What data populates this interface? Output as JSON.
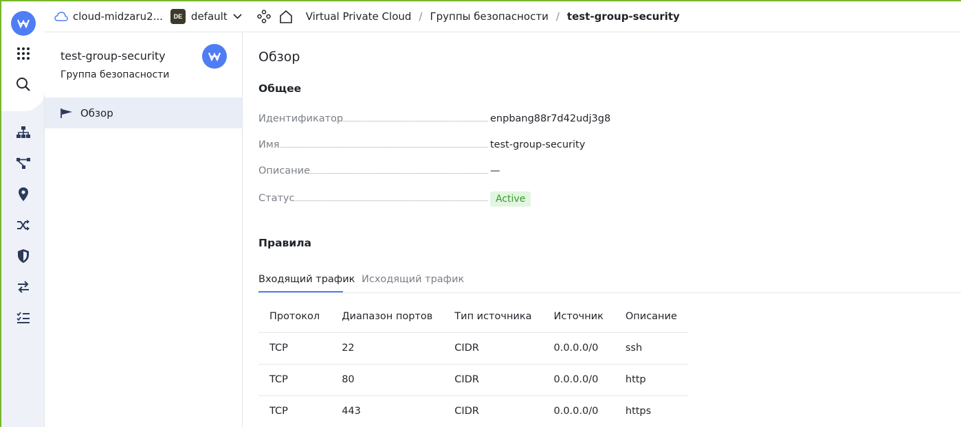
{
  "topbar": {
    "cloud_name": "cloud-midzaru2...",
    "folder_badge": "DE",
    "folder_name": "default",
    "breadcrumbs": [
      "Virtual Private Cloud",
      "Группы безопасности",
      "test-group-security"
    ],
    "separator": "/"
  },
  "rail": {
    "icons": [
      "logo-icon",
      "apps-grid-icon",
      "search-icon",
      "network-icon",
      "topology-icon",
      "location-pin-icon",
      "shuffle-icon",
      "shield-icon",
      "transfer-icon",
      "checklist-icon"
    ]
  },
  "resource": {
    "title": "test-group-security",
    "subtitle": "Группа безопасности",
    "nav": [
      {
        "label": "Обзор",
        "icon": "flag-icon"
      }
    ]
  },
  "main": {
    "heading": "Обзор",
    "general_heading": "Общее",
    "fields": [
      {
        "key": "Идентификатор",
        "value": "enpbang88r7d42udj3g8"
      },
      {
        "key": "Имя",
        "value": "test-group-security"
      },
      {
        "key": "Описание",
        "value": "—"
      },
      {
        "key": "Статус",
        "value": "Active"
      }
    ],
    "rules_heading": "Правила",
    "tabs": [
      {
        "label": "Входящий трафик",
        "active": true
      },
      {
        "label": "Исходящий трафик",
        "active": false
      }
    ],
    "table": {
      "columns": [
        "Протокол",
        "Диапазон портов",
        "Тип источника",
        "Источник",
        "Описание"
      ],
      "rows": [
        [
          "TCP",
          "22",
          "CIDR",
          "0.0.0.0/0",
          "ssh"
        ],
        [
          "TCP",
          "80",
          "CIDR",
          "0.0.0.0/0",
          "http"
        ],
        [
          "TCP",
          "443",
          "CIDR",
          "0.0.0.0/0",
          "https"
        ]
      ]
    }
  },
  "colors": {
    "accent": "#4f7df3",
    "frame": "#76b82a",
    "active_bg": "#e2f5e0",
    "active_text": "#3a9a2e"
  }
}
